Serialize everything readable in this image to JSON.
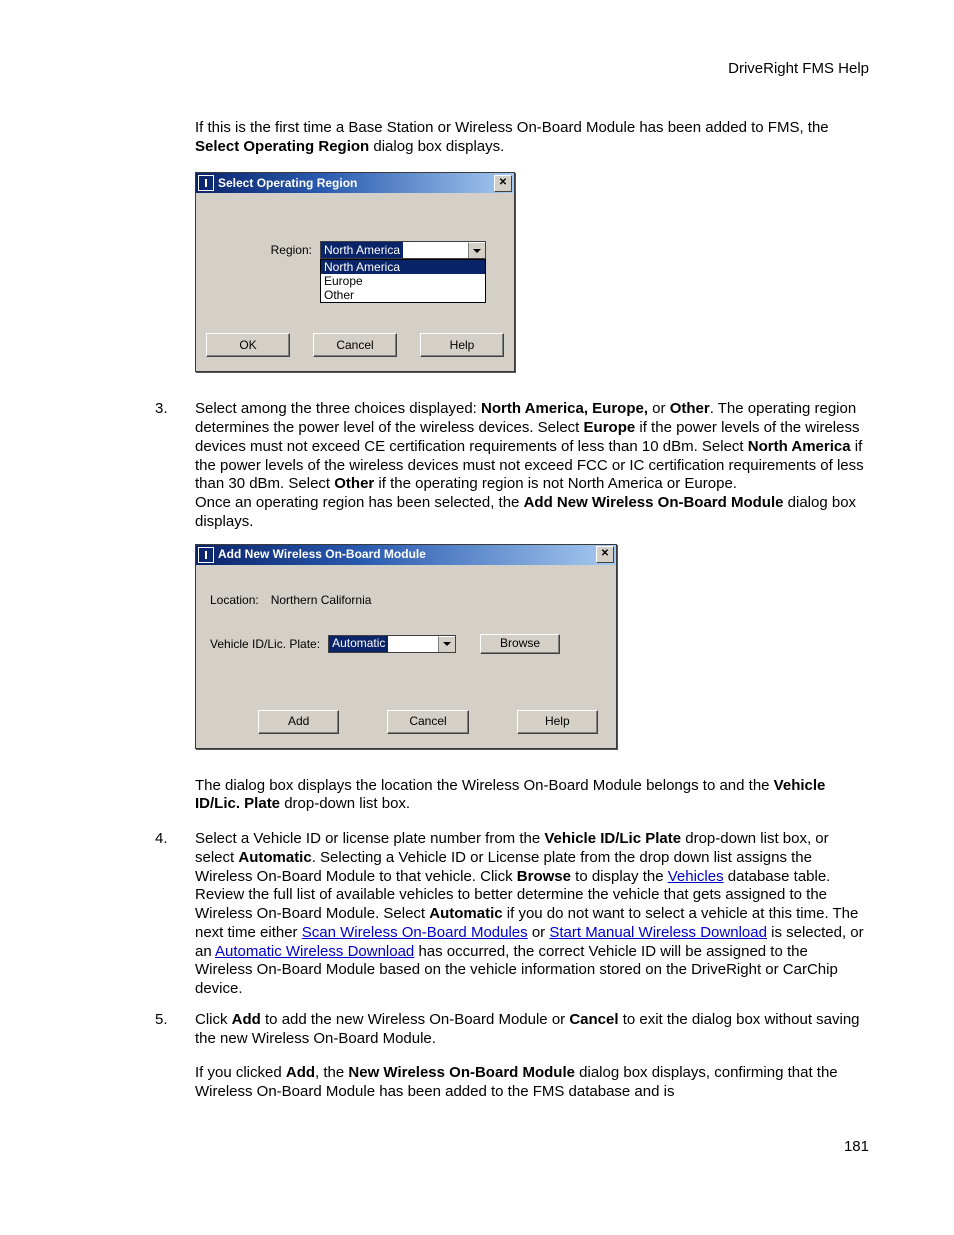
{
  "header": {
    "title": "DriveRight FMS Help"
  },
  "page_number": "181",
  "intro": {
    "t1": "If this is the first time a Base Station or Wireless On-Board Module has been added to FMS, the ",
    "b1": "Select Operating Region",
    "t2": " dialog box displays."
  },
  "dlg1": {
    "title": "Select Operating Region",
    "label": "Region:",
    "value": "North America",
    "options": [
      "North America",
      "Europe",
      "Other"
    ],
    "buttons": {
      "ok": "OK",
      "cancel": "Cancel",
      "help": "Help"
    }
  },
  "step3": {
    "num": "3.",
    "t1": "Select among the three choices displayed: ",
    "b1": "North America, Europe,",
    "t1b": " or ",
    "b1b": "Other",
    "t2": ". The operating region determines the power level of the wireless devices. Select ",
    "b2": "Europe",
    "t3": " if the power levels of the wireless devices must not exceed CE certification requirements of less than 10 dBm. Select ",
    "b3": "North America",
    "t4": " if the power levels of the wireless devices must not exceed FCC or IC certification requirements of less than 30 dBm. Select ",
    "b4": "Other",
    "t5": " if the operating region is not North America or Europe.",
    "t6a": "Once an operating region has been selected, the ",
    "b6": "Add New Wireless On-Board Module",
    "t6b": " dialog box displays."
  },
  "dlg2": {
    "title": "Add New Wireless On-Board Module",
    "loc_label": "Location:",
    "loc_value": "Northern California",
    "veh_label": "Vehicle ID/Lic. Plate:",
    "veh_value": "Automatic",
    "browse": "Browse",
    "buttons": {
      "add": "Add",
      "cancel": "Cancel",
      "help": "Help"
    }
  },
  "post_dlg2": {
    "t1": "The dialog box displays the location the Wireless On-Board Module belongs to and the ",
    "b1": "Vehicle ID/Lic. Plate",
    "t2": " drop-down list box."
  },
  "step4": {
    "num": "4.",
    "t1": "Select a Vehicle ID or license plate number from the ",
    "b1": "Vehicle ID/Lic Plate",
    "t2": " drop-down list box, or select ",
    "b2": "Automatic",
    "t3": ". Selecting a Vehicle ID or License plate from the drop down list assigns the Wireless On-Board Module to that vehicle. Click ",
    "b3": "Browse",
    "t4": " to display the ",
    "link1": "Vehicles",
    "t5": " database table. Review the full list of available vehicles to better determine the vehicle that gets assigned to the Wireless On-Board Module. Select ",
    "b4": "Automatic",
    "t6": " if you do not want to select a vehicle at this time. The next time either ",
    "link2": "Scan Wireless On-Board Modules",
    "t7": " or ",
    "link3": "Start Manual Wireless Download",
    "t8": " is selected, or an ",
    "link4": "Automatic Wireless Download",
    "t9": " has occurred, the correct Vehicle ID will be assigned to the Wireless On-Board Module based on the vehicle information stored on the DriveRight or CarChip device."
  },
  "step5": {
    "num": "5.",
    "t1": "Click ",
    "b1": "Add",
    "t2": " to add the new Wireless On-Board Module or ",
    "b2": "Cancel",
    "t3": " to exit the dialog box without saving the new Wireless On-Board Module.",
    "t4": "If you clicked ",
    "b4": "Add",
    "t5": ", the ",
    "b5": "New Wireless On-Board Module",
    "t6": " dialog box displays, confirming that the Wireless On-Board Module has been added to the FMS database and is"
  }
}
